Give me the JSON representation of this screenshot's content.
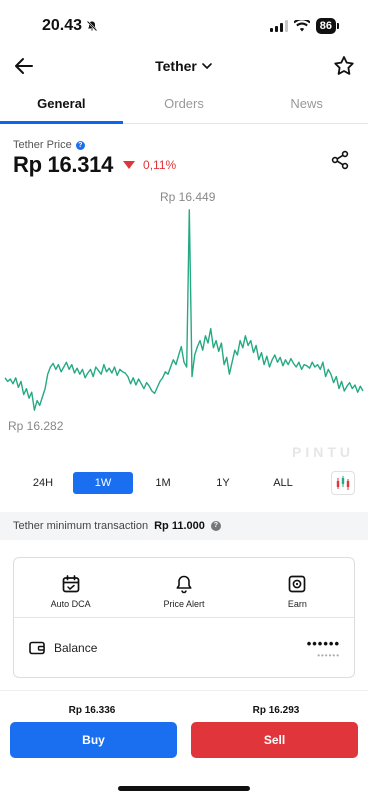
{
  "status_bar": {
    "time": "20.43",
    "battery": "86"
  },
  "header": {
    "title": "Tether"
  },
  "tabs": [
    {
      "label": "General",
      "active": true
    },
    {
      "label": "Orders",
      "active": false
    },
    {
      "label": "News",
      "active": false
    }
  ],
  "price": {
    "label": "Tether Price",
    "value": "Rp 16.314",
    "change": "0,11%",
    "direction": "down"
  },
  "chart_data": {
    "type": "line",
    "color": "#26a982",
    "high_label": "Rp 16.449",
    "low_label": "Rp 16.282",
    "watermark": "PINTU",
    "values": [
      16309,
      16306,
      16308,
      16304,
      16309,
      16301,
      16306,
      16295,
      16300,
      16292,
      16297,
      16282,
      16290,
      16286,
      16293,
      16300,
      16312,
      16318,
      16321,
      16316,
      16320,
      16314,
      16318,
      16322,
      16316,
      16320,
      16313,
      16317,
      16312,
      16316,
      16309,
      16313,
      16316,
      16310,
      16318,
      16315,
      16312,
      16320,
      16314,
      16317,
      16313,
      16318,
      16311,
      16316,
      16314,
      16313,
      16310,
      16304,
      16309,
      16303,
      16308,
      16304,
      16300,
      16305,
      16302,
      16298,
      16296,
      16301,
      16306,
      16309,
      16314,
      16312,
      16318,
      16324,
      16320,
      16328,
      16335,
      16322,
      16318,
      16449,
      16310,
      16328,
      16335,
      16340,
      16332,
      16344,
      16338,
      16350,
      16334,
      16340,
      16331,
      16338,
      16320,
      16326,
      16312,
      16322,
      16332,
      16328,
      16340,
      16334,
      16344,
      16336,
      16340,
      16330,
      16336,
      16324,
      16330,
      16320,
      16327,
      16318,
      16324,
      16328,
      16322,
      16326,
      16319,
      16324,
      16320,
      16325,
      16321,
      16318,
      16322,
      16316,
      16320,
      16319,
      16317,
      16322,
      16318,
      16320,
      16316,
      16322,
      16310,
      16316,
      16312,
      16305,
      16310,
      16300,
      16306,
      16298,
      16302,
      16305,
      16300,
      16303,
      16297,
      16302,
      16298
    ],
    "ylim": [
      16278,
      16453
    ]
  },
  "ranges": [
    {
      "label": "24H",
      "active": false
    },
    {
      "label": "1W",
      "active": true
    },
    {
      "label": "1M",
      "active": false
    },
    {
      "label": "1Y",
      "active": false
    },
    {
      "label": "ALL",
      "active": false
    }
  ],
  "min_transaction": {
    "label": "Tether minimum transaction",
    "value": "Rp 11.000"
  },
  "actions": [
    {
      "label": "Auto DCA",
      "icon": "calendar-icon"
    },
    {
      "label": "Price Alert",
      "icon": "bell-icon"
    },
    {
      "label": "Earn",
      "icon": "safe-icon"
    }
  ],
  "balance": {
    "label": "Balance",
    "masked_main": "••••••",
    "masked_sub": "••••••"
  },
  "trade": {
    "buy_price": "Rp 16.336",
    "sell_price": "Rp 16.293",
    "buy_label": "Buy",
    "sell_label": "Sell"
  }
}
